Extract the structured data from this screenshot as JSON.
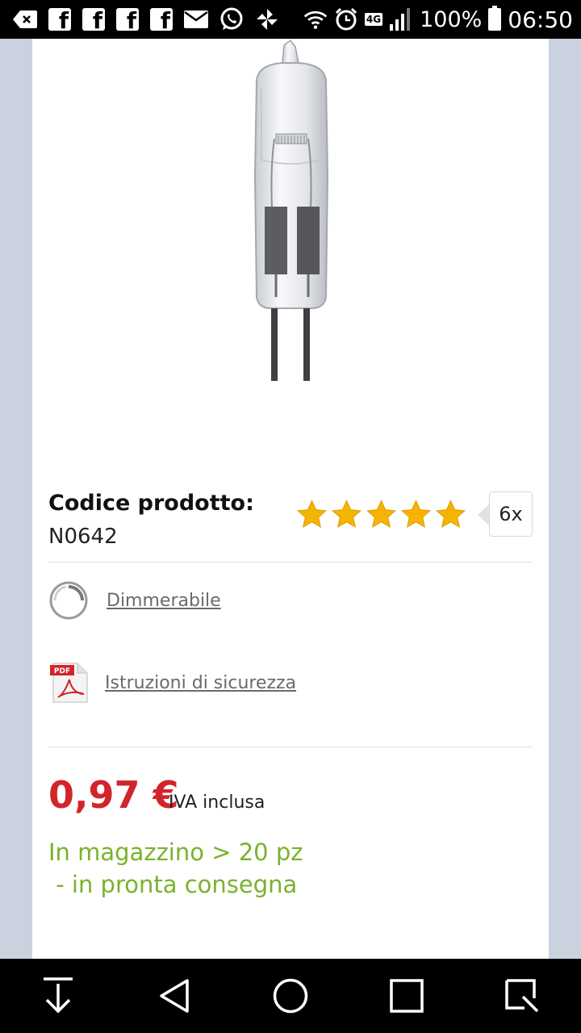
{
  "status_bar": {
    "battery": "100%",
    "time": "06:50",
    "network": "4G",
    "icons": [
      "notification-collapse-icon",
      "facebook-icon",
      "facebook-icon",
      "facebook-icon",
      "facebook-icon",
      "mail-icon",
      "whatsapp-icon",
      "pinwheel-icon",
      "wifi-icon",
      "alarm-icon",
      "network-4g-icon",
      "signal-icon",
      "battery-icon"
    ]
  },
  "product": {
    "code_label": "Codice prodotto:",
    "code_value": "N0642",
    "rating_stars": 5,
    "rating_max": 5,
    "review_count": "6x",
    "features": [
      {
        "icon": "dimmable-icon",
        "label": "Dimmerabile"
      },
      {
        "icon": "pdf-icon",
        "label": "Istruzioni di sicurezza",
        "pdf_badge": "PDF"
      }
    ],
    "price": "0,97 €",
    "vat_note": "IVA inclusa",
    "stock_text": "In magazzino > 20 pz\n - in pronta consegna"
  },
  "colors": {
    "price": "#d2252b",
    "stock": "#7ab22c",
    "star": "#f5b400",
    "background": "#c9d2de"
  },
  "nav_bar": {
    "buttons": [
      "notification-down-icon",
      "back-icon",
      "home-icon",
      "recents-icon",
      "capture-icon"
    ]
  }
}
